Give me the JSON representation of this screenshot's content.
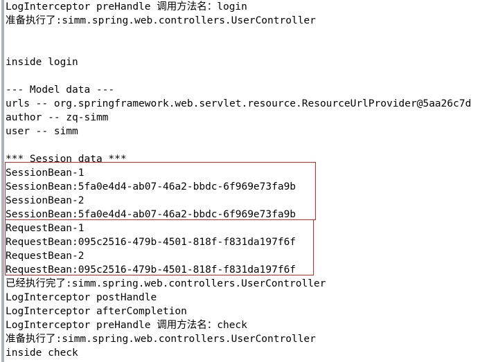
{
  "console": {
    "name": "spring-mvc-console-output",
    "gutter_color": "#a8b4c0",
    "background_color": "#ffffff",
    "text_color": "#000000",
    "annotation_color": "#e02020",
    "lines": [
      {
        "text": "LogInterceptor preHandle 调用方法名：login"
      },
      {
        "text": "准备执行了:simm.spring.web.controllers.UserController"
      },
      {
        "text": ""
      },
      {
        "text": ""
      },
      {
        "text": "inside login"
      },
      {
        "text": ""
      },
      {
        "text": "--- Model data ---"
      },
      {
        "text": "urls -- org.springframework.web.servlet.resource.ResourceUrlProvider@5aa26c7d"
      },
      {
        "text": "author -- zq-simm"
      },
      {
        "text": "user -- simm"
      },
      {
        "text": ""
      },
      {
        "text": "*** Session data ***"
      },
      {
        "text": "SessionBean-1"
      },
      {
        "text": "SessionBean:5fa0e4d4-ab07-46a2-bbdc-6f969e73fa9b"
      },
      {
        "text": "SessionBean-2"
      },
      {
        "text": "SessionBean:5fa0e4d4-ab07-46a2-bbdc-6f969e73fa9b"
      },
      {
        "text": "RequestBean-1"
      },
      {
        "text": "RequestBean:095c2516-479b-4501-818f-f831da197f6f"
      },
      {
        "text": "RequestBean-2"
      },
      {
        "text": "RequestBean:095c2516-479b-4501-818f-f831da197f6f"
      },
      {
        "text": "已经执行完了:simm.spring.web.controllers.UserController"
      },
      {
        "text": "LogInterceptor postHandle"
      },
      {
        "text": "LogInterceptor afterCompletion"
      },
      {
        "text": "LogInterceptor preHandle 调用方法名：check"
      },
      {
        "text": "准备执行了:simm.spring.web.controllers.UserController"
      },
      {
        "text": "inside check"
      }
    ]
  },
  "annotations": [
    {
      "label": "session-bean-highlight",
      "covers": "SessionBean-1 / SessionBean:5fa0e4d4-ab07-46a2-bbdc-6f969e73fa9b / SessionBean-2 / SessionBean:5fa0e4d4-ab07-46a2-bbdc-6f969e73fa9b"
    },
    {
      "label": "request-bean-highlight",
      "covers": "RequestBean-1 / RequestBean:095c2516-479b-4501-818f-f831da197f6f / RequestBean-2 / RequestBean:095c2516-479b-4501-818f-f831da197f6f"
    }
  ]
}
